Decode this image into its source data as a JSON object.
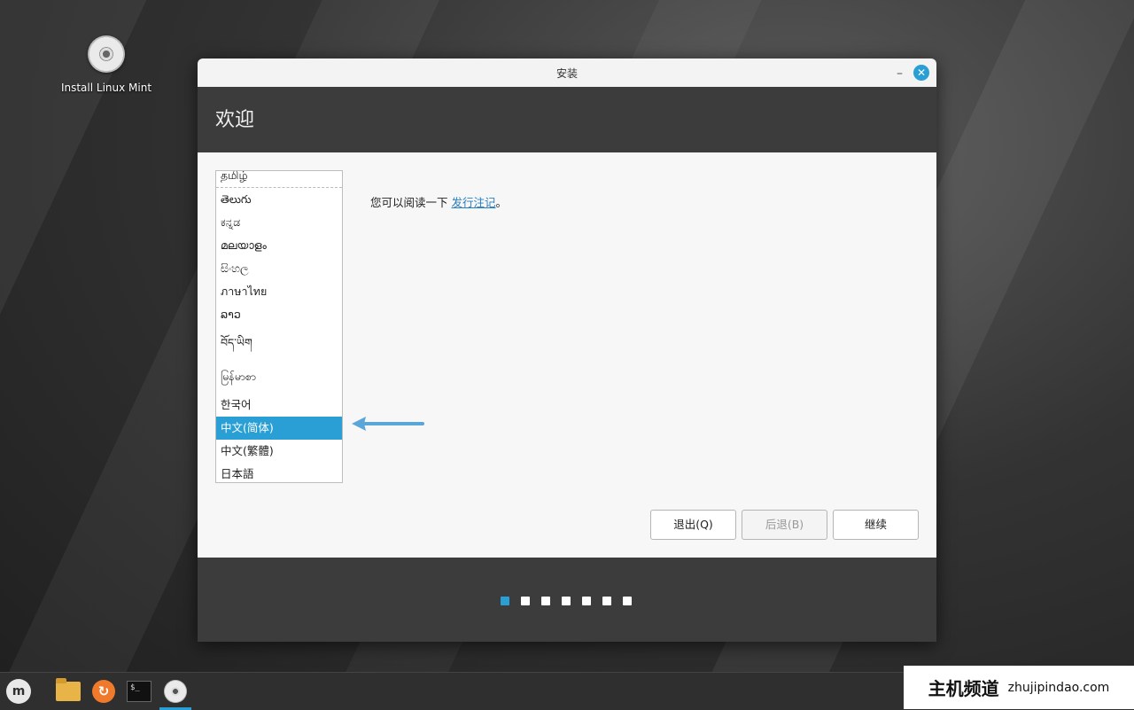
{
  "desktop": {
    "icon_label": "Install Linux Mint",
    "icon": "cd-icon"
  },
  "window": {
    "title": "安装",
    "minimize_label": "–",
    "close_label": "✕",
    "header": "欢迎",
    "languages": [
      {
        "label": "தமிழ்"
      },
      {
        "label": "తెలుగు"
      },
      {
        "label": "ಕನ್ನಡ"
      },
      {
        "label": "മലയാളം"
      },
      {
        "label": "සිංහල"
      },
      {
        "label": "ภาษาไทย"
      },
      {
        "label": "ລາວ"
      },
      {
        "label": "བོད་ཡིག"
      },
      {
        "label": "မြန်မာစာ"
      },
      {
        "label": "한국어"
      },
      {
        "label": "中文(简体)",
        "selected": true
      },
      {
        "label": "中文(繁體)"
      },
      {
        "label": "日本語"
      }
    ],
    "notes_prefix": "您可以阅读一下",
    "notes_link": "发行注记",
    "notes_suffix": "。",
    "buttons": {
      "quit": "退出(Q)",
      "back": "后退(B)",
      "continue": "继续"
    },
    "progress": {
      "total_steps": 7,
      "current_step": 1
    },
    "accent_color": "#2a9fd6"
  },
  "taskbar": {
    "items": [
      "mint-menu-icon",
      "folder-icon",
      "update-manager-icon",
      "terminal-icon",
      "installer-cd-icon"
    ],
    "terminal_glyph": "$_",
    "mint_glyph": "m",
    "update_glyph": "↻"
  },
  "watermark": {
    "cn": "主机频道",
    "en": "zhujipindao.com"
  }
}
